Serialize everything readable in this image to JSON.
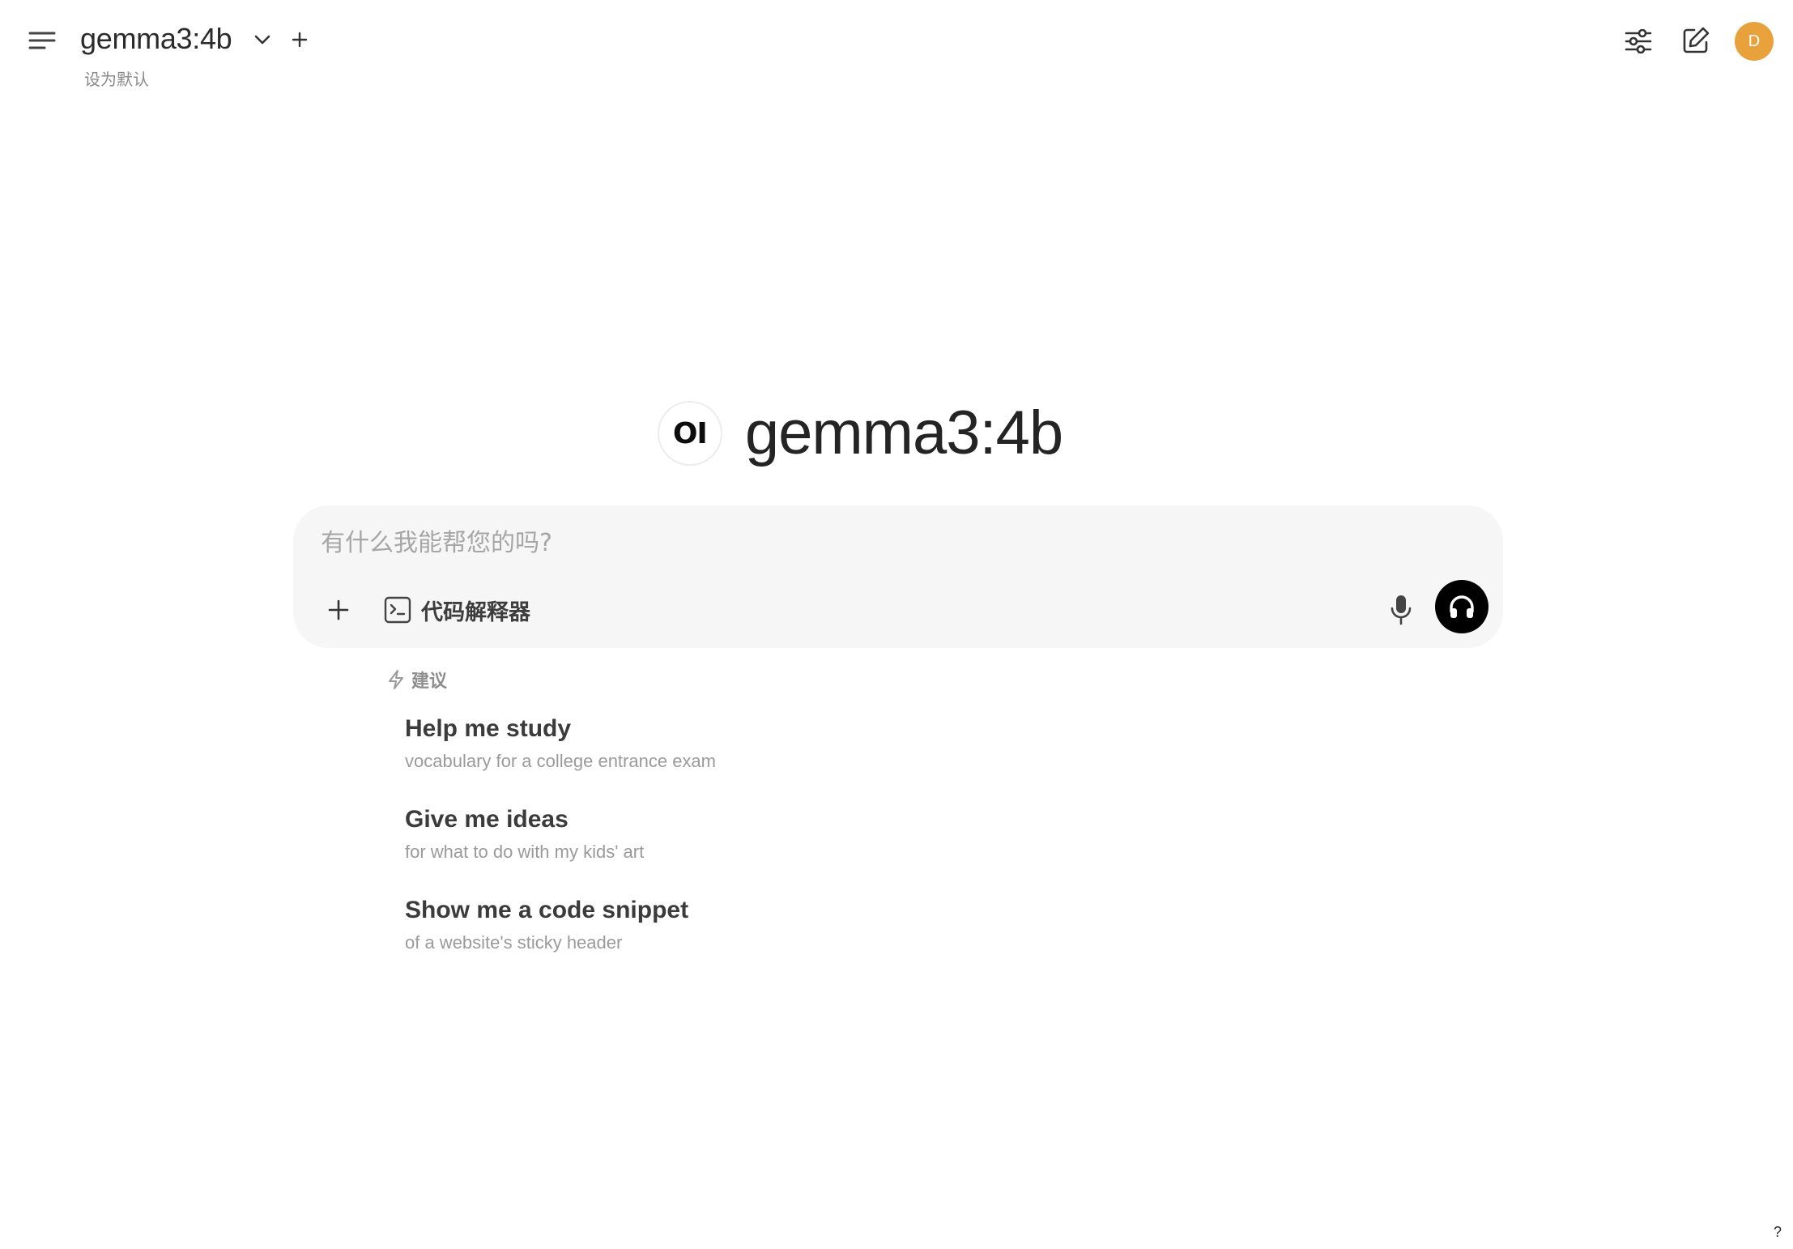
{
  "header": {
    "model_name": "gemma3:4b",
    "set_default_label": "设为默认",
    "avatar_initial": "D",
    "avatar_color": "#e9a23b",
    "icons": [
      "menu-icon",
      "chevron-down-icon",
      "plus-icon",
      "sliders-icon",
      "edit-icon"
    ]
  },
  "hero": {
    "logo_text": "OI",
    "title": "gemma3:4b"
  },
  "composer": {
    "placeholder": "有什么我能帮您的吗?",
    "value": "",
    "code_interpreter_label": "代码解释器",
    "icons": [
      "plus-icon",
      "terminal-icon",
      "microphone-icon",
      "headphones-icon"
    ],
    "voice_button_color": "#000000"
  },
  "suggestions": {
    "header_label": "建议",
    "items": [
      {
        "title": "Help me study",
        "subtitle": "vocabulary for a college entrance exam"
      },
      {
        "title": "Give me ideas",
        "subtitle": "for what to do with my kids' art"
      },
      {
        "title": "Show me a code snippet",
        "subtitle": "of a website's sticky header"
      }
    ]
  },
  "footer": {
    "help_label": "?"
  }
}
